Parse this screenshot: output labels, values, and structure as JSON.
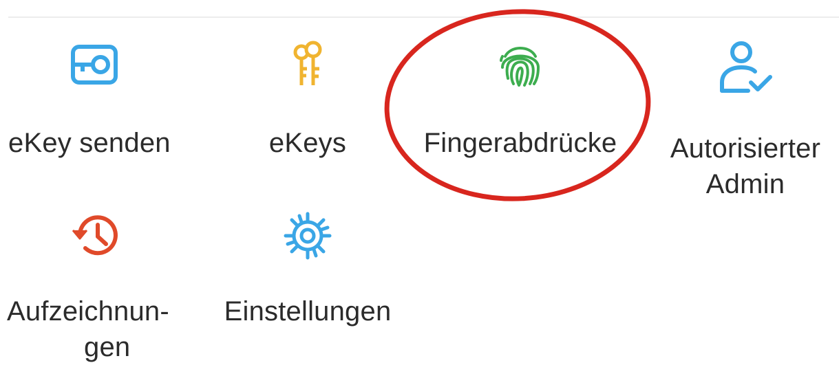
{
  "menu": {
    "items": [
      {
        "label": "eKey senden",
        "icon": "key-card-icon",
        "color": "#3aa6e6"
      },
      {
        "label": "eKeys",
        "icon": "keys-icon",
        "color": "#f0b430"
      },
      {
        "label": "Fingerabdrücke",
        "icon": "fingerprint-icon",
        "color": "#3dad4f"
      },
      {
        "label_line1": "Autorisierter",
        "label_line2": "Admin",
        "icon": "user-check-icon",
        "color": "#3aa6e6"
      },
      {
        "label_line1": "Aufzeichnun-",
        "label_line2": "gen",
        "icon": "history-icon",
        "color": "#e04a2a"
      },
      {
        "label": "Einstellungen",
        "icon": "gear-icon",
        "color": "#3aa6e6"
      }
    ]
  },
  "annotation": {
    "highlight_color": "#d8261e",
    "highlighted_item": "Fingerabdrücke"
  }
}
